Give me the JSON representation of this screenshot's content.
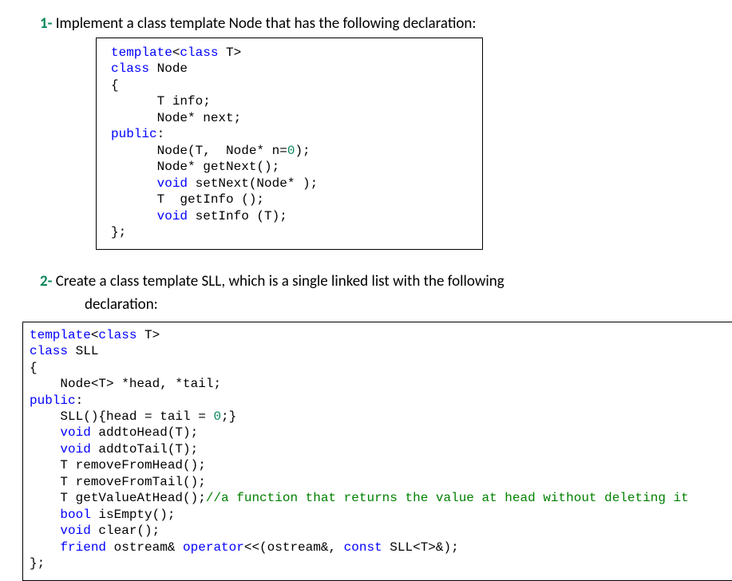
{
  "q1": {
    "number": "1-",
    "text": " Implement a class template Node that has the following declaration:"
  },
  "code1": {
    "l1a": "template",
    "l1b": "<",
    "l1c": "class",
    "l1d": " T",
    "l1e": ">",
    "l2a": "class",
    "l2b": " Node",
    "l3": "{",
    "l4": "      T info;",
    "l5": "      Node* next;",
    "l6a": "public",
    "l6b": ":",
    "l7a": "      Node(T,  Node* n=",
    "l7b": "0",
    "l7c": ");",
    "l8": "      Node* getNext();",
    "l9a": "      ",
    "l9b": "void",
    "l9c": " setNext(Node* );",
    "l10": "      T  getInfo ();",
    "l11a": "      ",
    "l11b": "void",
    "l11c": " setInfo (T);",
    "l12": "};"
  },
  "q2": {
    "number": "2-",
    "text": " Create a class template SLL, which is a single linked list with the following",
    "sub": "declaration:"
  },
  "code2": {
    "l1a": "template",
    "l1b": "<",
    "l1c": "class",
    "l1d": " T",
    "l1e": ">",
    "l2a": "class",
    "l2b": " SLL",
    "l3": "{",
    "l4": "    Node<T> *head, *tail;",
    "l5a": "public",
    "l5b": ":",
    "l6a": "    SLL(){head = tail = ",
    "l6b": "0",
    "l6c": ";}",
    "l7a": "    ",
    "l7b": "void",
    "l7c": " addtoHead(T);",
    "l8a": "    ",
    "l8b": "void",
    "l8c": " addtoTail(T);",
    "l9": "    T removeFromHead();",
    "l10": "    T removeFromTail();",
    "l11a": "    T getValueAtHead();",
    "l11b": "//a function that returns the value at head without deleting it",
    "l12a": "    ",
    "l12b": "bool",
    "l12c": " isEmpty();",
    "l13a": "    ",
    "l13b": "void",
    "l13c": " clear();",
    "l14a": "    ",
    "l14b": "friend",
    "l14c": " ostream& ",
    "l14d": "operator",
    "l14e": "<<(ostream&, ",
    "l14f": "const",
    "l14g": " SLL<T>&);",
    "l15": "};"
  }
}
